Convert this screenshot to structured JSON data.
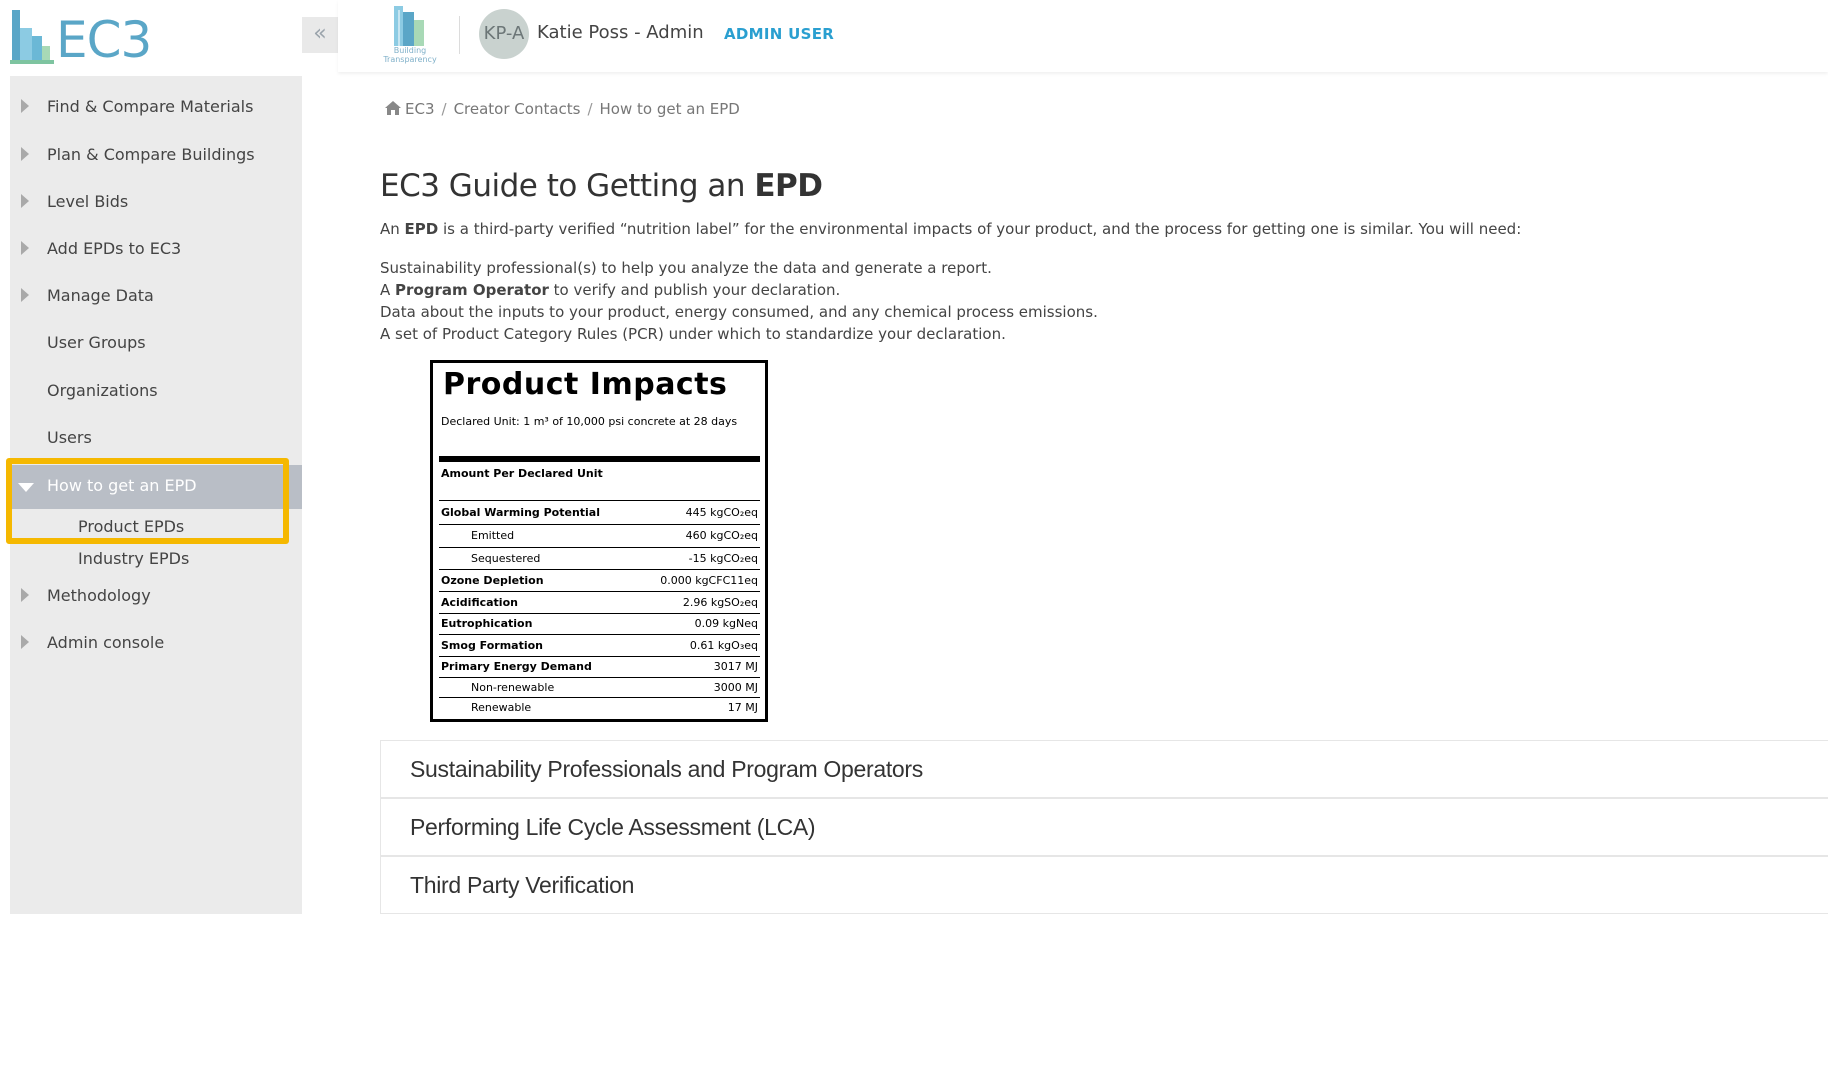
{
  "app": {
    "logo_text": "EC3",
    "bt_logo_caption": "Building Transparency"
  },
  "sidebar": {
    "collapse_icon": "«",
    "items": [
      {
        "label": "Find & Compare Materials",
        "has_caret": true
      },
      {
        "label": "Plan & Compare Buildings",
        "has_caret": true
      },
      {
        "label": "Level Bids",
        "has_caret": true
      },
      {
        "label": "Add EPDs to EC3",
        "has_caret": true
      },
      {
        "label": "Manage Data",
        "has_caret": true
      },
      {
        "label": "User Groups",
        "has_caret": false
      },
      {
        "label": "Organizations",
        "has_caret": false
      },
      {
        "label": "Users",
        "has_caret": false
      },
      {
        "label": "How to get an EPD",
        "has_caret": true,
        "active": true
      },
      {
        "label": "Product EPDs"
      },
      {
        "label": "Industry EPDs"
      },
      {
        "label": "Methodology",
        "has_caret": true
      },
      {
        "label": "Admin console",
        "has_caret": true
      }
    ],
    "highlight_color": "#f5b800"
  },
  "header": {
    "avatar_initials": "KP-A",
    "user_name": "Katie Poss - Admin",
    "user_role": "ADMIN USER"
  },
  "breadcrumb": [
    "EC3",
    "Creator Contacts",
    "How to get an EPD"
  ],
  "page": {
    "title_prefix": "EC3 Guide to Getting an ",
    "title_bold": "EPD",
    "intro_prefix": "An ",
    "intro_bold": "EPD",
    "intro_suffix": " is a third-party verified “nutrition label” for the environmental impacts of your product, and the process for getting one is similar. You will need:",
    "list_1": "Sustainability professional(s) to help you analyze the data and generate a report.",
    "list_2_prefix": "A ",
    "list_2_bold": "Program Operator",
    "list_2_suffix": " to verify and publish your declaration.",
    "list_3": "Data about the inputs to your product, energy consumed, and any chemical process emissions.",
    "list_4": "A set of Product Category Rules (PCR) under which to standardize your declaration."
  },
  "impact_label": {
    "title": "Product Impacts",
    "declared_unit": "Declared Unit: 1 m³ of 10,000 psi concrete at 28 days",
    "amount_header": "Amount Per Declared Unit",
    "rows": [
      {
        "name": "Global Warming Potential",
        "value": "445 kgCO₂eq"
      },
      {
        "name": "Emitted",
        "value": "460 kgCO₂eq"
      },
      {
        "name": "Sequestered",
        "value": "-15 kgCO₂eq"
      },
      {
        "name": "Ozone Depletion",
        "value": "0.000 kgCFC11eq"
      },
      {
        "name": "Acidification",
        "value": "2.96 kgSO₂eq"
      },
      {
        "name": "Eutrophication",
        "value": "0.09 kgNeq"
      },
      {
        "name": "Smog Formation",
        "value": "0.61 kgO₃eq"
      },
      {
        "name": "Primary Energy Demand",
        "value": "3017 MJ"
      },
      {
        "name": "Non-renewable",
        "value": "3000 MJ"
      },
      {
        "name": "Renewable",
        "value": "17 MJ"
      }
    ]
  },
  "accordion": [
    "Sustainability Professionals and Program Operators",
    "Performing Life Cycle Assessment (LCA)",
    "Third Party Verification"
  ]
}
